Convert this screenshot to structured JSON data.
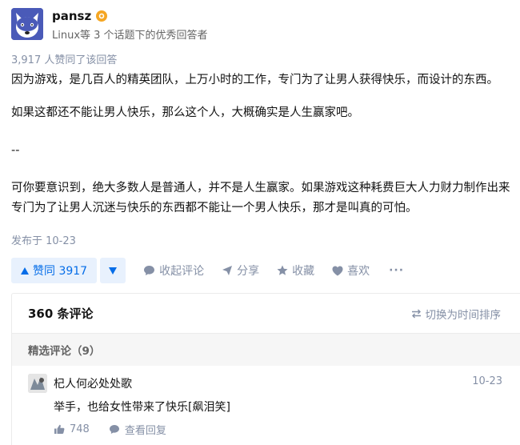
{
  "author": {
    "name": "pansz",
    "description": "Linux等 3 个话题下的优秀回答者"
  },
  "answer": {
    "vote_summary": "3,917 人赞同了该回答",
    "paragraphs": [
      "因为游戏，是几百人的精英团队，上万小时的工作，专门为了让男人获得快乐，而设计的东西。",
      "如果这都还不能让男人快乐，那么这个人，大概确实是人生赢家吧。",
      "--",
      "可你要意识到，绝大多数人是普通人，并不是人生赢家。如果游戏这种耗费巨大人力财力制作出来",
      "专门为了让男人沉迷与快乐的东西都不能让一个男人快乐，那才是叫真的可怕。"
    ],
    "published": "发布于 10-23"
  },
  "actions": {
    "vote_up": "赞同 3917",
    "collapse_comments": "收起评论",
    "share": "分享",
    "favorite": "收藏",
    "like": "喜欢",
    "more": "···"
  },
  "comments": {
    "title": "360 条评论",
    "switch_sort": "切换为时间排序",
    "featured_label": "精选评论（9）",
    "items": [
      {
        "user": "杞人何必处处歌",
        "date": "10-23",
        "text": "举手，也给女性带来了快乐[飙泪笑]",
        "likes": "748",
        "view_replies": "查看回复"
      }
    ]
  },
  "colors": {
    "accent": "#056de8",
    "accent_bg": "#e8f1fd",
    "muted": "#8590a6",
    "badge": "#f5a623"
  }
}
